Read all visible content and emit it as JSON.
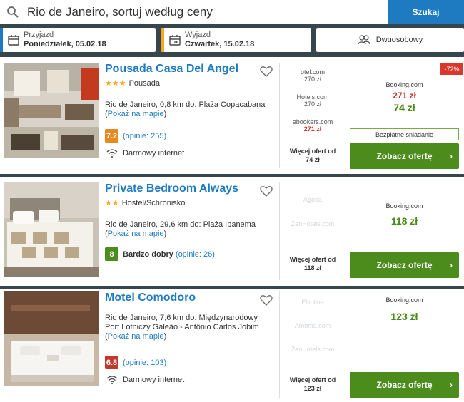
{
  "search": {
    "query": "Rio de Janeiro, sortuj według ceny",
    "button_label": "Szukaj"
  },
  "dates": {
    "checkin_label": "Przyjazd",
    "checkin_value": "Poniedziałek, 05.02.18",
    "checkout_label": "Wyjazd",
    "checkout_value": "Czwartek, 15.02.18",
    "room_label": "Dwuosobowy"
  },
  "colors": {
    "accent": "#1f7bc1",
    "checkin_stripe": "#1f7bc1",
    "checkout_stripe": "#f5a623",
    "cta": "#4c8c1c"
  },
  "hotels": [
    {
      "name": "Pousada Casa Del Angel",
      "stars": "★★★",
      "type": "Pousada",
      "location": "Rio de Janeiro, 0,8 km do: Plaża Copacabana",
      "map_link": "Pokaż na mapie",
      "score": "7.2",
      "score_color": "#e8891d",
      "score_text": "",
      "reviews": "(opinie: 255)",
      "amenity": "Darmowy internet",
      "offers": [
        {
          "site": "otel.com",
          "price": "270 zł"
        },
        {
          "site": "Hotels.com",
          "price": "270 zł"
        },
        {
          "site": "ebookers.com",
          "price": "271 zł"
        }
      ],
      "more_offers": "Więcej ofert od",
      "more_price": "74 zł",
      "deal_site": "Booking.com",
      "old_price": "271 zł",
      "price": "74 zł",
      "discount": "-72%",
      "breakfast": "Bezpłatne śniadanie",
      "cta": "Zobacz ofertę"
    },
    {
      "name": "Private Bedroom Always",
      "stars": "★★",
      "type": "Hostel/Schronisko",
      "location": "Rio de Janeiro, 29,6 km do: Plaża Ipanema",
      "map_link": "Pokaż na mapie",
      "score": "8",
      "score_color": "#4c8c1c",
      "score_text": "Bardzo dobry",
      "reviews": "(opinie: 26)",
      "offers": [
        {
          "site": "Agoda",
          "price": ""
        },
        {
          "site": "ZenHotels.com",
          "price": ""
        }
      ],
      "more_offers": "Więcej ofert od",
      "more_price": "118 zł",
      "deal_site": "Booking.com",
      "price": "118 zł",
      "cta": "Zobacz ofertę"
    },
    {
      "name": "Motel Comodoro",
      "location_line1": "Rio de Janeiro, 7,6 km do: Międzynarodowy",
      "location_line2": "Port Lotniczy Galeão - Antônio Carlos Jobim",
      "map_link": "Pokaż na mapie",
      "score": "6.8",
      "score_color": "#c0392b",
      "reviews": "(opinie: 103)",
      "amenity": "Darmowy internet",
      "offers": [
        {
          "site": "Elvoline",
          "price": ""
        },
        {
          "site": "Amoma.com",
          "price": ""
        },
        {
          "site": "ZenHotels.com",
          "price": ""
        }
      ],
      "more_offers": "Więcej ofert od",
      "more_price": "123 zł",
      "deal_site": "Booking.com",
      "price": "123 zł",
      "cta": "Zobacz ofertę"
    }
  ]
}
